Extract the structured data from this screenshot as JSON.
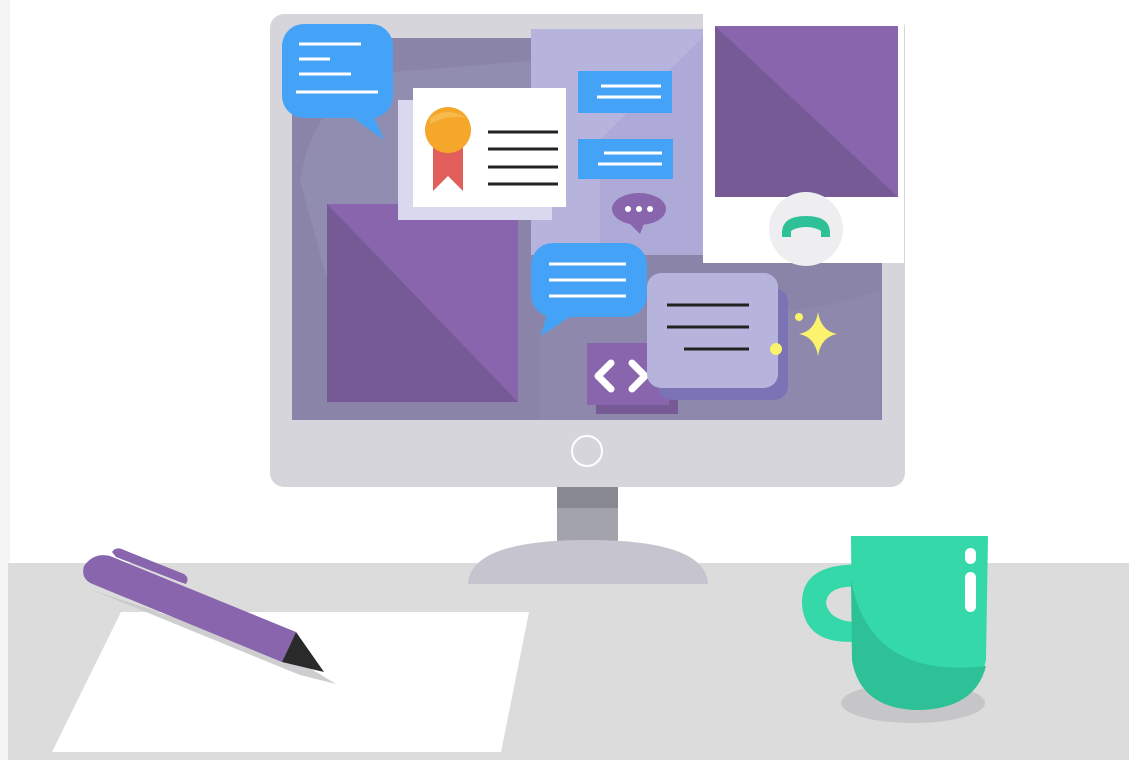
{
  "scene": {
    "subject": "online-meeting-desk-illustration",
    "elements": [
      "monitor",
      "video-tile-left",
      "video-tile-right",
      "chat-bubble",
      "certificate-card",
      "code-icon",
      "hang-up-button",
      "sparkle-icon",
      "pen",
      "paper-sheet",
      "coffee-mug"
    ]
  },
  "colors": {
    "background": "#ffffff",
    "left_margin": "#f6f5f6",
    "desk": "#dcdcdc",
    "monitor_bezel": "#d7d5dc",
    "screen": "#8a85a8",
    "purple": "#8865ac",
    "purple_dark": "#755a96",
    "lavender": "#b6b3dc",
    "chat_blue": "#45a3f7",
    "teal": "#35d8a8",
    "teal_dark": "#2ec197",
    "yellow": "#fbf36d",
    "badge_orange": "#f4a72a",
    "ribbon_red": "#e25e5a",
    "ink": "#222222"
  }
}
